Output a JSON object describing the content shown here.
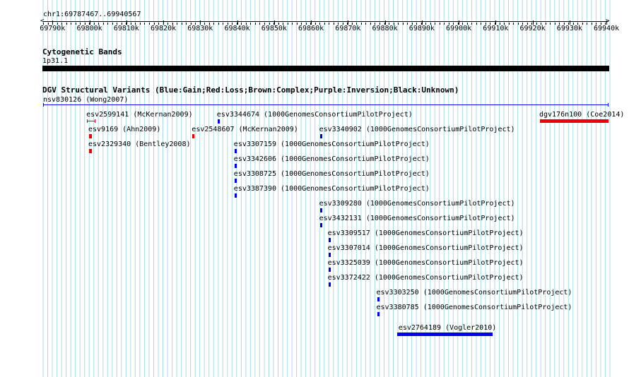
{
  "position_label": "chr1:69787467..69940567",
  "ruler": {
    "ticks": [
      "69790k",
      "69800k",
      "69810k",
      "69820k",
      "69830k",
      "69840k",
      "69850k",
      "69860k",
      "69870k",
      "69880k",
      "69890k",
      "69900k",
      "69910k",
      "69920k",
      "69930k",
      "69940k"
    ]
  },
  "cytoband": {
    "title": "Cytogenetic Bands",
    "band_label": "1p31.1"
  },
  "dgv": {
    "title": "DGV Structural Variants (Blue:Gain;Red:Loss;Brown:Complex;Purple:Inversion;Black:Unknown)",
    "features": [
      {
        "label": "nsv830126 (Wong2007)",
        "start": 69787467,
        "end": 69940567,
        "row": 0,
        "type": "gain",
        "style": "line"
      },
      {
        "label": "esv2599141 (McKernan2009)",
        "start": 69799350,
        "end": 69801700,
        "row": 1,
        "type": "loss",
        "style": "bracket"
      },
      {
        "label": "esv3344674 (1000GenomesConsortiumPilotProject)",
        "start": 69834700,
        "end": 69835100,
        "row": 1,
        "type": "gain",
        "style": "box"
      },
      {
        "label": "dgv176n100 (Coe2014)",
        "start": 69922000,
        "end": 69940567,
        "row": 1,
        "type": "loss",
        "style": "box"
      },
      {
        "label": "esv9169 (Ahn2009)",
        "start": 69799900,
        "end": 69800600,
        "row": 2,
        "type": "loss",
        "style": "box"
      },
      {
        "label": "esv2548607 (McKernan2009)",
        "start": 69827900,
        "end": 69828200,
        "row": 2,
        "type": "loss",
        "style": "box"
      },
      {
        "label": "esv3340902 (1000GenomesConsortiumPilotProject)",
        "start": 69862400,
        "end": 69862800,
        "row": 2,
        "type": "gain",
        "style": "box"
      },
      {
        "label": "esv2329340 (Bentley2008)",
        "start": 69799900,
        "end": 69800600,
        "row": 3,
        "type": "loss",
        "style": "box"
      },
      {
        "label": "esv3307159 (1000GenomesConsortiumPilotProject)",
        "start": 69839300,
        "end": 69839700,
        "row": 3,
        "type": "gain",
        "style": "box"
      },
      {
        "label": "esv3342606 (1000GenomesConsortiumPilotProject)",
        "start": 69839300,
        "end": 69839700,
        "row": 4,
        "type": "gain",
        "style": "box"
      },
      {
        "label": "esv3308725 (1000GenomesConsortiumPilotProject)",
        "start": 69839300,
        "end": 69839700,
        "row": 5,
        "type": "gain",
        "style": "box"
      },
      {
        "label": "esv3387390 (1000GenomesConsortiumPilotProject)",
        "start": 69839300,
        "end": 69839700,
        "row": 6,
        "type": "gain",
        "style": "box"
      },
      {
        "label": "esv3309280 (1000GenomesConsortiumPilotProject)",
        "start": 69862400,
        "end": 69862800,
        "row": 7,
        "type": "gain",
        "style": "box"
      },
      {
        "label": "esv3432131 (1000GenomesConsortiumPilotProject)",
        "start": 69862400,
        "end": 69862800,
        "row": 8,
        "type": "gain",
        "style": "box"
      },
      {
        "label": "esv3309517 (1000GenomesConsortiumPilotProject)",
        "start": 69864700,
        "end": 69865100,
        "row": 9,
        "type": "gain",
        "style": "box"
      },
      {
        "label": "esv3307014 (1000GenomesConsortiumPilotProject)",
        "start": 69864700,
        "end": 69865100,
        "row": 10,
        "type": "gain",
        "style": "box"
      },
      {
        "label": "esv3325039 (1000GenomesConsortiumPilotProject)",
        "start": 69864700,
        "end": 69865100,
        "row": 11,
        "type": "gain",
        "style": "box"
      },
      {
        "label": "esv3372422 (1000GenomesConsortiumPilotProject)",
        "start": 69864700,
        "end": 69865100,
        "row": 12,
        "type": "gain",
        "style": "box"
      },
      {
        "label": "esv3303250 (1000GenomesConsortiumPilotProject)",
        "start": 69877900,
        "end": 69878300,
        "row": 13,
        "type": "gain",
        "style": "box"
      },
      {
        "label": "esv3380785 (1000GenomesConsortiumPilotProject)",
        "start": 69877900,
        "end": 69878300,
        "row": 14,
        "type": "gain",
        "style": "box"
      },
      {
        "label": "esv2764189 (Vogler2010)",
        "start": 69883300,
        "end": 69909100,
        "row": 15,
        "type": "gain",
        "style": "box"
      }
    ]
  },
  "colors": {
    "grid": "#a8dde6",
    "gain": "#0000ee",
    "loss": "#ee0000",
    "cytoband": "#000000",
    "text": "#000000"
  }
}
